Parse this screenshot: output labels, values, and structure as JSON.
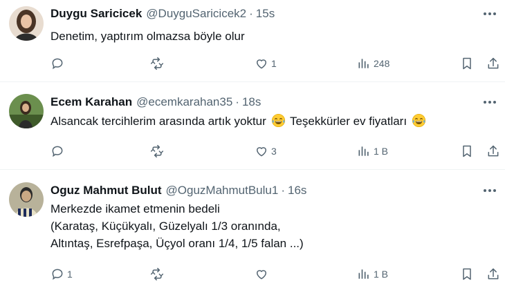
{
  "tweets": [
    {
      "name": "Duygu Saricicek",
      "handle": "@DuyguSaricicek2",
      "time": "15s",
      "lines": [
        "Denetim, yaptırım olmazsa böyle olur"
      ],
      "stats": {
        "replies": "",
        "retweets": "",
        "likes": "1",
        "views": "248"
      }
    },
    {
      "name": "Ecem Karahan",
      "handle": "@ecemkarahan35",
      "time": "18s",
      "text_before_emoji": "Alsancak tercihlerim arasında artık yoktur",
      "text_after_emoji": "Teşekkürler ev fiyatları",
      "emoji": "face-with-tears-of-joy",
      "stats": {
        "replies": "",
        "retweets": "",
        "likes": "3",
        "views": "1 B"
      }
    },
    {
      "name": "Oguz Mahmut Bulut",
      "handle": "@OguzMahmutBulu1",
      "time": "16s",
      "lines": [
        "Merkezde ikamet etmenin bedeli",
        "(Karataş,  Küçükyalı, Güzelyalı 1/3 oranında,",
        "Altıntaş, Esrefpaşa, Üçyol oranı 1/4, 1/5 falan ...)"
      ],
      "stats": {
        "replies": "1",
        "retweets": "",
        "likes": "",
        "views": "1 B"
      }
    }
  ],
  "separator": "·",
  "icons": [
    "more-icon",
    "reply-icon",
    "retweet-icon",
    "like-icon",
    "views-icon",
    "bookmark-icon",
    "share-icon"
  ],
  "colors": {
    "text": "#0f1419",
    "secondary": "#536471",
    "divider": "#eff3f4"
  }
}
